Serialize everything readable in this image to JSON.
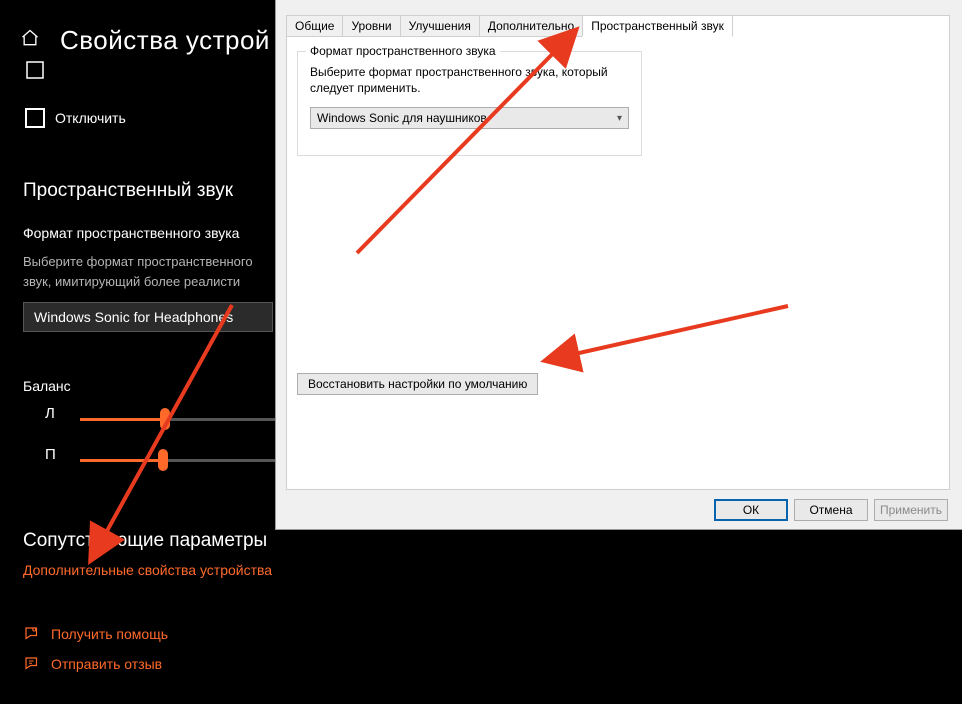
{
  "settings": {
    "title": "Свойства устрой",
    "disable": "Отключить",
    "spatial_heading": "Пространственный звук",
    "format_label": "Формат пространственного звука",
    "format_desc": "Выберите формат пространственного звук, имитирующий более реалисти",
    "dropdown_value": "Windows Sonic for Headphones",
    "balance_heading": "Баланс",
    "left": "Л",
    "right": "П",
    "related_heading": "Сопутствующие параметры",
    "extra_link": "Дополнительные свойства устройства",
    "help": "Получить помощь",
    "feedback": "Отправить отзыв"
  },
  "dialog": {
    "tabs": [
      "Общие",
      "Уровни",
      "Улучшения",
      "Дополнительно",
      "Пространственный звук"
    ],
    "active_tab": 4,
    "group_legend": "Формат пространственного звука",
    "group_text": "Выберите формат пространственного звука, который следует применить.",
    "combo_value": "Windows Sonic для наушников",
    "restore": "Восстановить настройки по умолчанию",
    "ok": "ОК",
    "cancel": "Отмена",
    "apply": "Применить"
  }
}
